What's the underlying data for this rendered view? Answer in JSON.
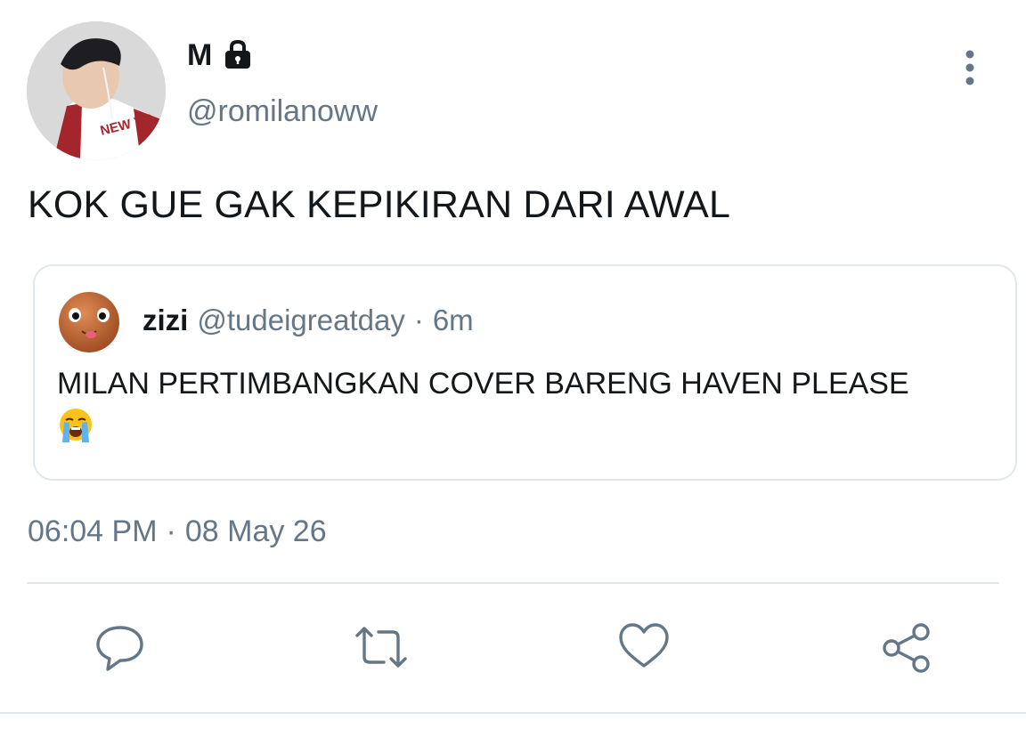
{
  "author": {
    "display_name": "M",
    "handle": "@romilanoww",
    "avatar_text": "NEW YO",
    "protected_icon": "lock-icon"
  },
  "tweet": {
    "text": "KOK GUE GAK KEPIKIRAN DARI AWAL"
  },
  "quoted_tweet": {
    "display_name": "zizi",
    "handle": "@tudeigreatday",
    "separator": "·",
    "time": "6m",
    "text": "MILAN PERTIMBANGKAN COVER BARENG HAVEN PLEASE",
    "emoji": "loudly-crying-face-emoji"
  },
  "meta": {
    "time": "06:04 PM",
    "separator": "·",
    "date": "08 May 26"
  },
  "actions": [
    {
      "icon": "reply-icon"
    },
    {
      "icon": "retweet-icon"
    },
    {
      "icon": "like-icon"
    },
    {
      "icon": "share-icon"
    }
  ],
  "colors": {
    "text_primary": "#14171a",
    "text_secondary": "#657786",
    "border": "#e1e8ed",
    "icon": "#657786"
  }
}
